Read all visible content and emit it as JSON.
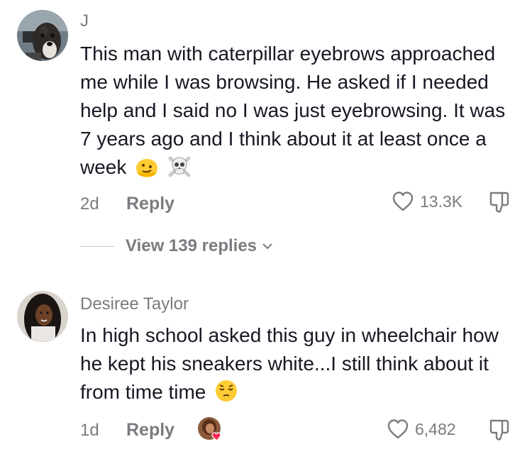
{
  "comments": [
    {
      "username": "J",
      "text": "This man with caterpillar eyebrows approached me while I was browsing. He asked if I needed help and I said no I was just eyebrowsing. It was 7 years ago and I think about it at least once a week",
      "emojis": [
        "melting-face",
        "skull-crossbones"
      ],
      "age": "2d",
      "reply_label": "Reply",
      "likes": "13.3K",
      "view_replies": "View 139 replies"
    },
    {
      "username": "Desiree Taylor",
      "text": "In high school asked this guy in wheelchair how he kept his sneakers white...I still think about it from time time",
      "emojis": [
        "pensive-face"
      ],
      "age": "1d",
      "reply_label": "Reply",
      "likes": "6,482"
    }
  ],
  "icons": {
    "like": "heart-outline-icon",
    "dislike": "thumbs-down-icon",
    "chevron": "chevron-down-icon"
  },
  "colors": {
    "text": "#161823",
    "muted": "#7b7b80",
    "heart": "#fe2c55"
  }
}
